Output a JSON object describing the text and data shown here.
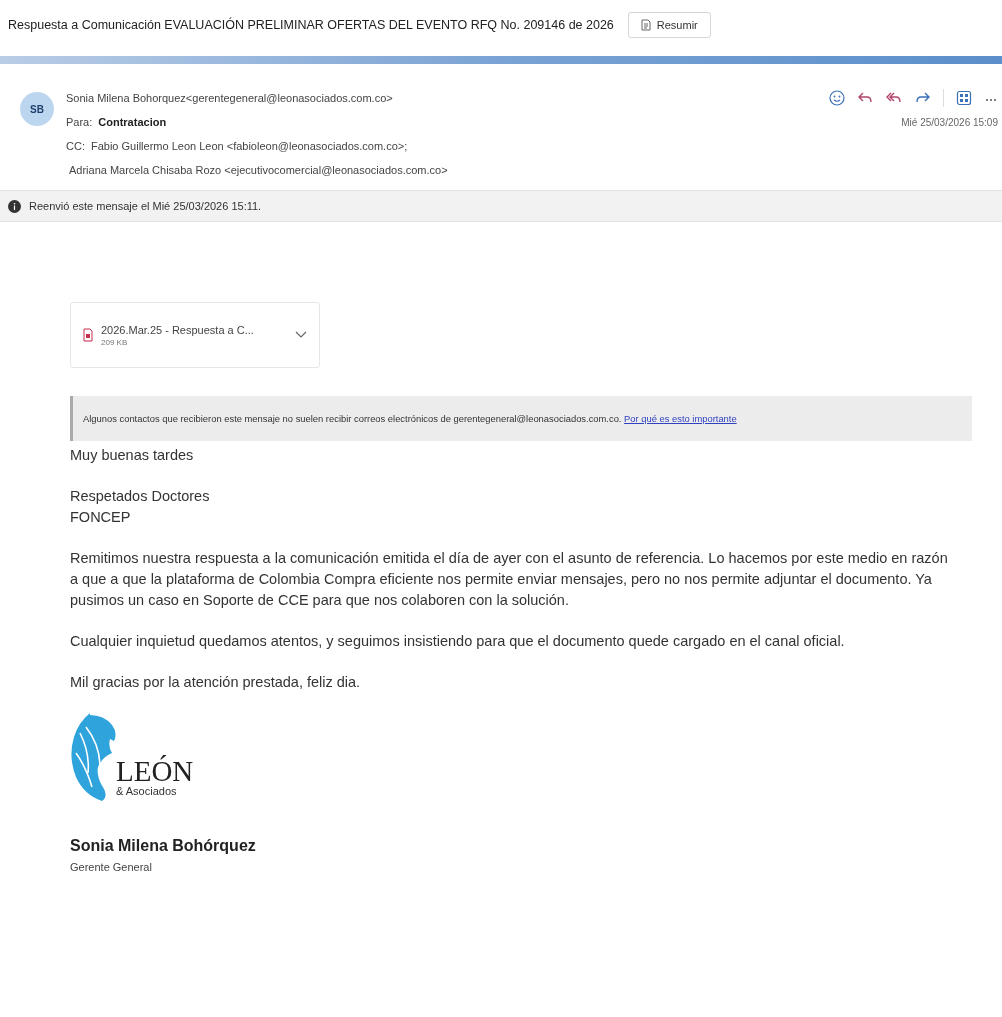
{
  "subject": "Respuesta a Comunicación EVALUACIÓN PRELIMINAR OFERTAS DEL EVENTO RFQ No. 209146 de 2026",
  "summarize_button": "Resumir",
  "sender": {
    "initials": "SB",
    "name": "Sonia Milena Bohorquez<gerentegeneral@leonasociados.com.co>"
  },
  "to": {
    "label": "Para:",
    "value": "Contratacion"
  },
  "date": "Mié 25/03/2026 15:09",
  "cc": {
    "label": "CC:",
    "entries": [
      "Fabio Guillermo Leon Leon <fabioleon@leonasociados.com.co>;",
      "Adriana Marcela Chisaba Rozo <ejecutivocomercial@leonasociados.com.co>"
    ]
  },
  "notice": "Reenvió este mensaje el Mié 25/03/2026 15:11.",
  "attachment": {
    "name": "2026.Mar.25 - Respuesta a C...",
    "size": "209 KB"
  },
  "warning": {
    "text": "Algunos contactos que recibieron este mensaje no suelen recibir correos electrónicos de gerentegeneral@leonasociados.com.co.",
    "link": "Por qué es esto importante"
  },
  "body": [
    "Muy buenas tardes",
    "Respetados Doctores\nFONCEP",
    "Remitimos nuestra respuesta a la comunicación emitida el día de ayer con el asunto de referencia. Lo hacemos por este medio en razón a que a que la plataforma de Colombia Compra eficiente nos permite enviar mensajes, pero no nos permite adjuntar el documento. Ya pusimos un caso en Soporte de CCE para que nos colaboren con la solución.",
    "Cualquier inquietud quedamos atentos, y seguimos insistiendo para que el documento quede cargado en el canal oficial.",
    "Mil gracias por la atención prestada, feliz dia."
  ],
  "signature": {
    "logo_name": "LEÓN",
    "logo_sub": "& Asociados",
    "name": "Sonia Milena Bohórquez",
    "title": "Gerente General"
  }
}
